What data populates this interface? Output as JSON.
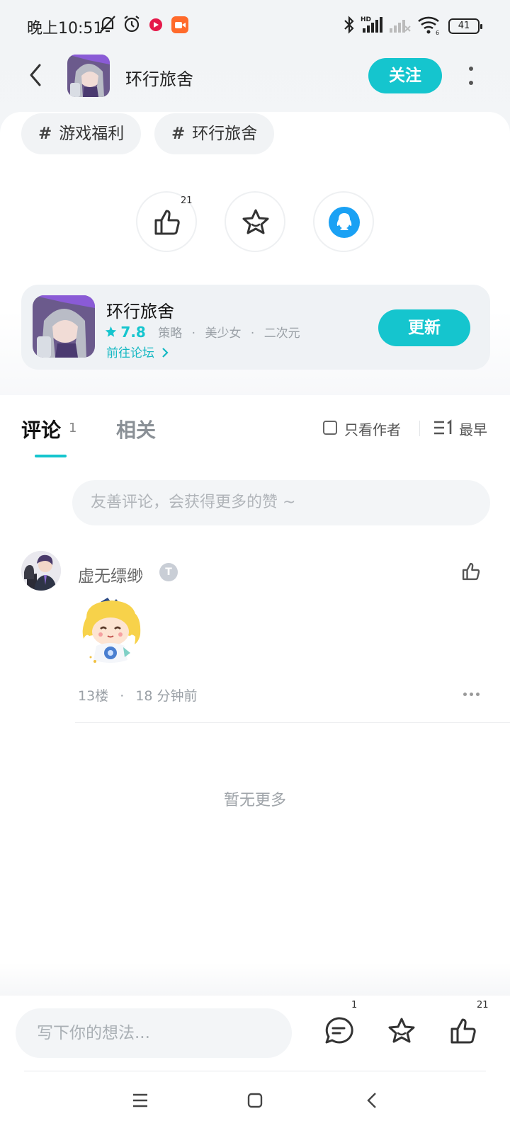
{
  "status_bar": {
    "time": "晚上10:51",
    "battery": "41",
    "icons": [
      "silent-bell-icon",
      "alarm-icon",
      "app-notification-icon",
      "video-app-icon",
      "bluetooth-icon",
      "signal-hd-icon",
      "signal-empty-icon",
      "wifi-icon",
      "battery-icon"
    ]
  },
  "header": {
    "title": "环行旅舍",
    "follow_label": "关注",
    "accent_color": "#15c5ce"
  },
  "tags": [
    {
      "label": "游戏福利"
    },
    {
      "label": "环行旅舍"
    }
  ],
  "actions": {
    "like_count": "21"
  },
  "game": {
    "name": "环行旅舍",
    "score": "7.8",
    "category_1": "策略",
    "category_2": "美少女",
    "category_3": "二次元",
    "separator": "·",
    "forum_link": "前往论坛",
    "update_label": "更新"
  },
  "tabs": {
    "comment_label": "评论",
    "comment_count": "1",
    "related_label": "相关",
    "author_only_label": "只看作者",
    "sort_label": "最早"
  },
  "comment_input": {
    "placeholder": "友善评论，会获得更多的赞 ~"
  },
  "comments": [
    {
      "username": "虚无缥缈",
      "badge": "T",
      "floor": "13楼",
      "separator": "·",
      "time": "18 分钟前"
    }
  ],
  "no_more_label": "暂无更多",
  "bottom_bar": {
    "input_placeholder": "写下你的想法...",
    "comment_count": "1",
    "like_count": "21"
  }
}
